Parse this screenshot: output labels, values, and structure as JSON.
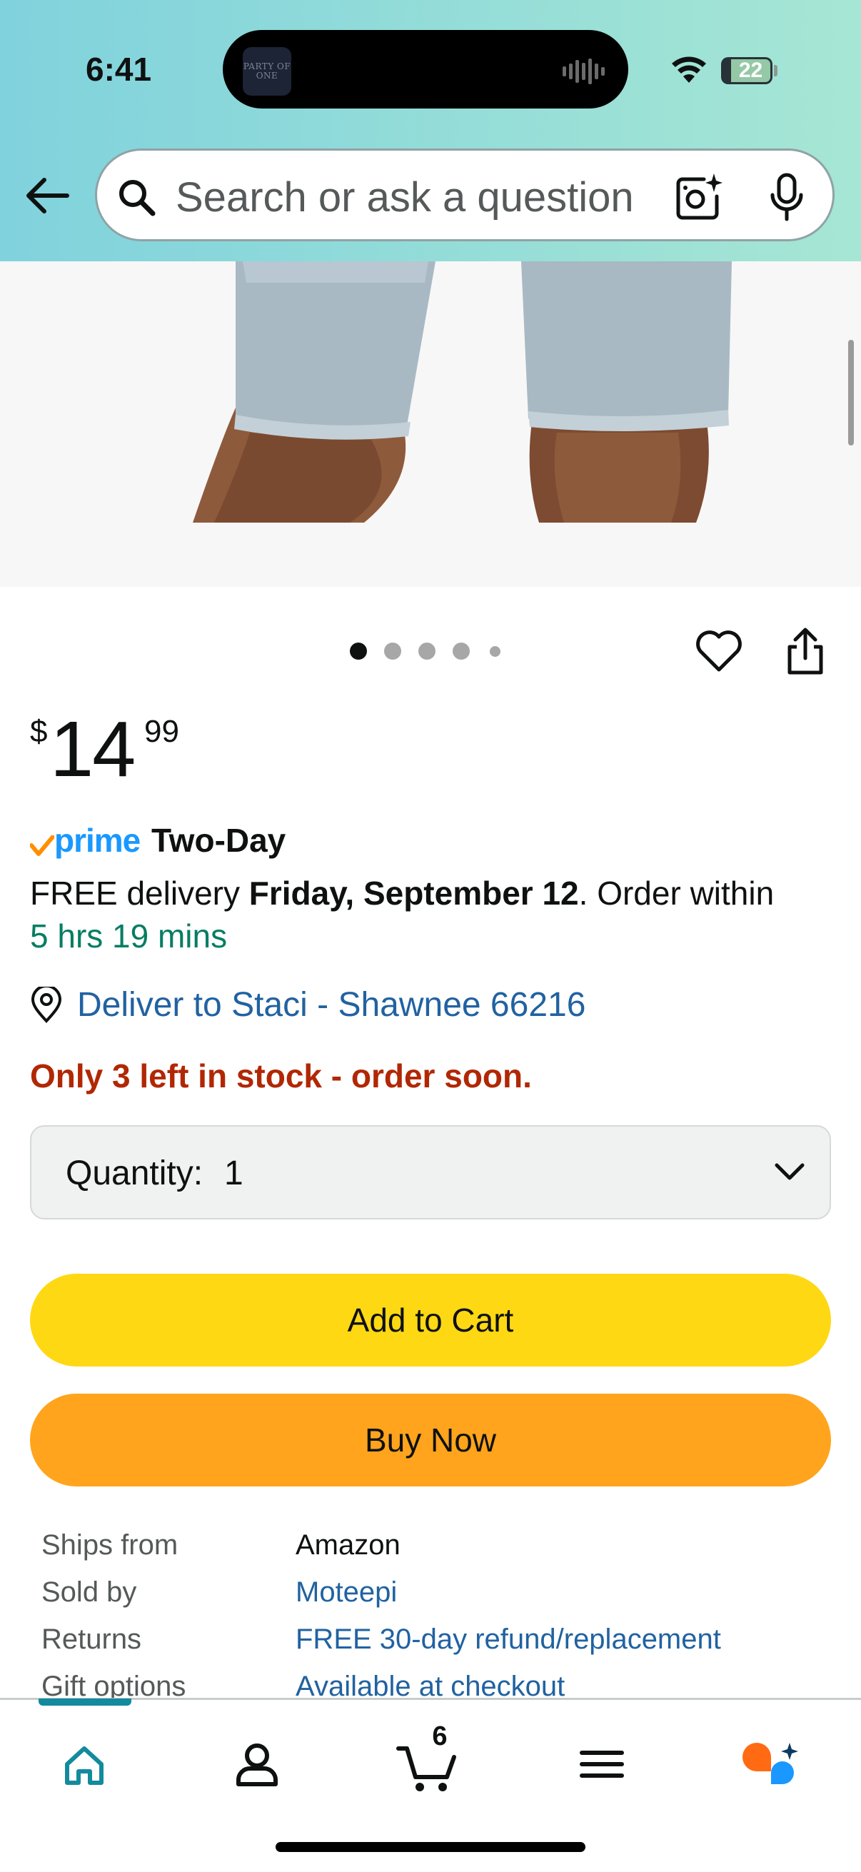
{
  "status_bar": {
    "time": "6:41",
    "now_playing_art_text": "PARTY OF ONE",
    "battery_level": "22"
  },
  "header": {
    "search_placeholder": "Search or ask a question",
    "icons": [
      "back-arrow-icon",
      "search-icon",
      "camera-lens-icon",
      "microphone-icon"
    ]
  },
  "gallery": {
    "image_count": 5,
    "active_index": 0,
    "icons": [
      "heart-icon",
      "share-icon"
    ]
  },
  "price": {
    "symbol": "$",
    "whole": "14",
    "fraction": "99"
  },
  "delivery": {
    "prime_label": "prime",
    "speed": "Two-Day",
    "prefix": "FREE delivery ",
    "date": "Friday, September 12",
    "suffix": ". Order within",
    "countdown": "5 hrs 19 mins",
    "deliver_to": "Deliver to Staci - Shawnee 66216"
  },
  "stock": {
    "message": "Only 3 left in stock - order soon."
  },
  "quantity": {
    "label": "Quantity:",
    "value": "1"
  },
  "actions": {
    "add_to_cart": "Add to Cart",
    "buy_now": "Buy Now"
  },
  "details": [
    {
      "label": "Ships from",
      "value": "Amazon",
      "link": false
    },
    {
      "label": "Sold by",
      "value": "Moteepi",
      "link": true
    },
    {
      "label": "Returns",
      "value": "FREE 30-day refund/replacement",
      "link": true
    },
    {
      "label": "Gift options",
      "value": "Available at checkout",
      "link": true
    }
  ],
  "bottom_nav": {
    "items": [
      "home-icon",
      "account-icon",
      "cart-icon",
      "menu-icon",
      "rufus-assistant-icon"
    ],
    "active": "home-icon",
    "cart_count": "6"
  },
  "colors": {
    "header_gradient_start": "#80d2dd",
    "header_gradient_end": "#a6e6d4",
    "add_to_cart": "#ffd814",
    "buy_now": "#ffa41c",
    "link": "#2162a1",
    "countdown": "#067d62",
    "stock_warning": "#b12704",
    "prime_blue": "#1a98ff",
    "nav_active": "#138a9e"
  }
}
